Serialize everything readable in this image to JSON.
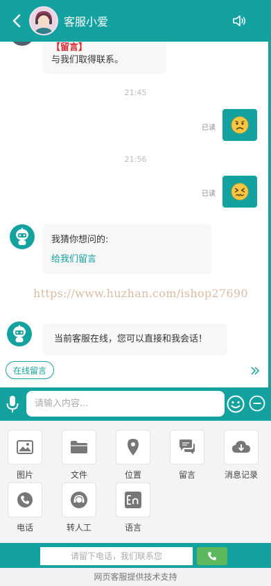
{
  "header": {
    "title": "客服小爱",
    "icons": {
      "back": "chevron-left-icon",
      "speaker": "speaker-icon"
    }
  },
  "messages": {
    "leave_msg_tag": "【留言】",
    "leave_msg_text": "与我们取得联系。",
    "time1": "21:45",
    "read1": "已读",
    "time2": "21:56",
    "read2": "已读",
    "guess_title": "我猜你想问的:",
    "guess_link": "给我们留言",
    "online_text": "当前客服在线，您可以直接和我会话！"
  },
  "watermark": "https://www.huzhan.com/ishop27690",
  "quick": {
    "online_msg_btn": "在线留言"
  },
  "input": {
    "placeholder": "请输入内容..."
  },
  "functions": [
    {
      "label": "图片",
      "icon": "image-icon"
    },
    {
      "label": "文件",
      "icon": "folder-icon"
    },
    {
      "label": "位置",
      "icon": "location-icon"
    },
    {
      "label": "留言",
      "icon": "chat-bubbles-icon"
    },
    {
      "label": "消息记录",
      "icon": "cloud-download-icon"
    },
    {
      "label": "电话",
      "icon": "phone-icon"
    },
    {
      "label": "转人工",
      "icon": "transfer-agent-icon"
    },
    {
      "label": "语言",
      "icon": "language-icon"
    }
  ],
  "bottom": {
    "phone_placeholder": "请留下电话，我们联系您"
  },
  "footer": {
    "text": "网页客服提供技术支持"
  },
  "colors": {
    "brand": "#14a2a0",
    "call_green": "#5cb85c",
    "tag_red": "#d9262a",
    "link": "#14a2a0"
  }
}
